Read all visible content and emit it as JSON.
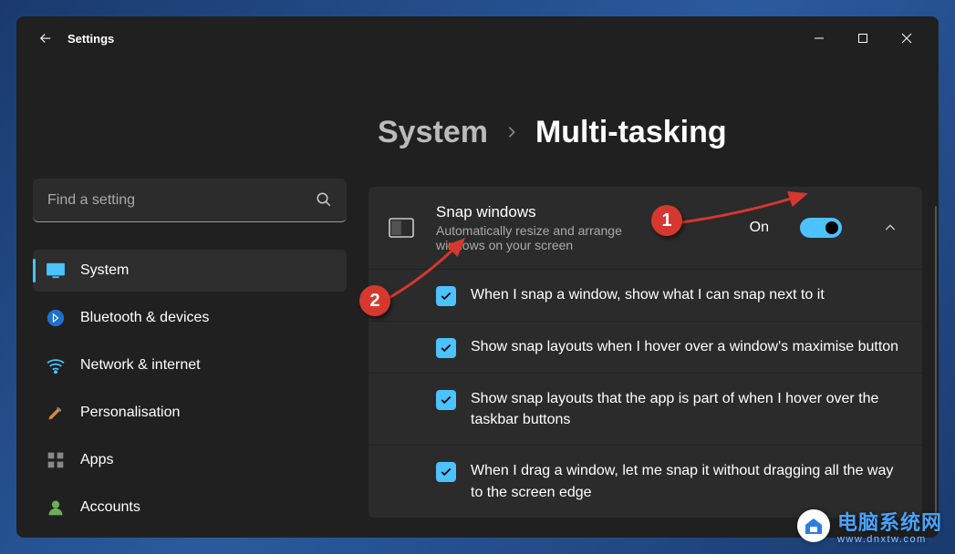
{
  "app": {
    "title": "Settings"
  },
  "search": {
    "placeholder": "Find a setting"
  },
  "nav": [
    {
      "id": "system",
      "label": "System"
    },
    {
      "id": "bluetooth",
      "label": "Bluetooth & devices"
    },
    {
      "id": "network",
      "label": "Network & internet"
    },
    {
      "id": "personalisation",
      "label": "Personalisation"
    },
    {
      "id": "apps",
      "label": "Apps"
    },
    {
      "id": "accounts",
      "label": "Accounts"
    }
  ],
  "breadcrumb": {
    "parent": "System",
    "current": "Multi-tasking"
  },
  "snap": {
    "title": "Snap windows",
    "subtitle": "Automatically resize and arrange windows on your screen",
    "state_label": "On",
    "options": [
      "When I snap a window, show what I can snap next to it",
      "Show snap layouts when I hover over a window's maximise button",
      "Show snap layouts that the app is part of when I hover over the taskbar buttons",
      "When I drag a window, let me snap it without dragging all the way to the screen edge"
    ]
  },
  "annotations": {
    "marker1": "1",
    "marker2": "2"
  },
  "watermark": {
    "text_cn": "电脑系统网",
    "url": "www.dnxtw.com"
  },
  "colors": {
    "accent": "#4cc2ff",
    "anno": "#d6382f"
  }
}
